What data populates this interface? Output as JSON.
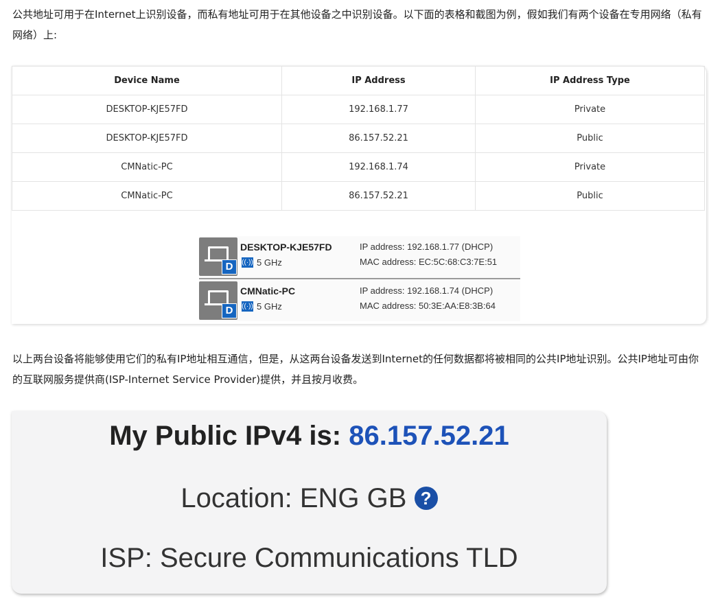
{
  "intro_text": "公共地址可用于在Internet上识别设备，而私有地址可用于在其他设备之中识别设备。以下面的表格和截图为例，假如我们有两个设备在专用网络（私有网络）上:",
  "table": {
    "headers": [
      "Device Name",
      "IP Address",
      "IP Address Type"
    ],
    "rows": [
      [
        "DESKTOP-KJE57FD",
        "192.168.1.77",
        "Private"
      ],
      [
        "DESKTOP-KJE57FD",
        "86.157.52.21",
        "Public"
      ],
      [
        "CMNatic-PC",
        "192.168.1.74",
        "Private"
      ],
      [
        "CMNatic-PC",
        "86.157.52.21",
        "Public"
      ]
    ]
  },
  "devices": [
    {
      "name": "DESKTOP-KJE57FD",
      "badge": "D",
      "band": "5 GHz",
      "ip": "IP address: 192.168.1.77 (DHCP)",
      "mac": "MAC address: EC:5C:68:C3:7E:51"
    },
    {
      "name": "CMNatic-PC",
      "badge": "D",
      "band": "5 GHz",
      "ip": "IP address: 192.168.1.74 (DHCP)",
      "mac": "MAC address: 50:3E:AA:E8:3B:64"
    }
  ],
  "icons": {
    "wifi": "wifi-signal-icon",
    "device": "laptop-icon",
    "help": "question-circle-icon"
  },
  "explanation_text": "以上两台设备将能够使用它们的私有IP地址相互通信，但是，从这两台设备发送到Internet的任何数据都将被相同的公共IP地址识别。公共IP地址可由你的互联网服务提供商(ISP-Internet Service Provider)提供，并且按月收费。",
  "public_ip": {
    "label": "My Public IPv4 is: ",
    "value": "86.157.52.21",
    "location": "Location: ENG GB",
    "isp": "ISP: Secure Communications TLD"
  },
  "colors": {
    "ip_value": "#1d52b8",
    "badge_blue": "#1565c0",
    "help_icon": "#1a4fa6"
  }
}
